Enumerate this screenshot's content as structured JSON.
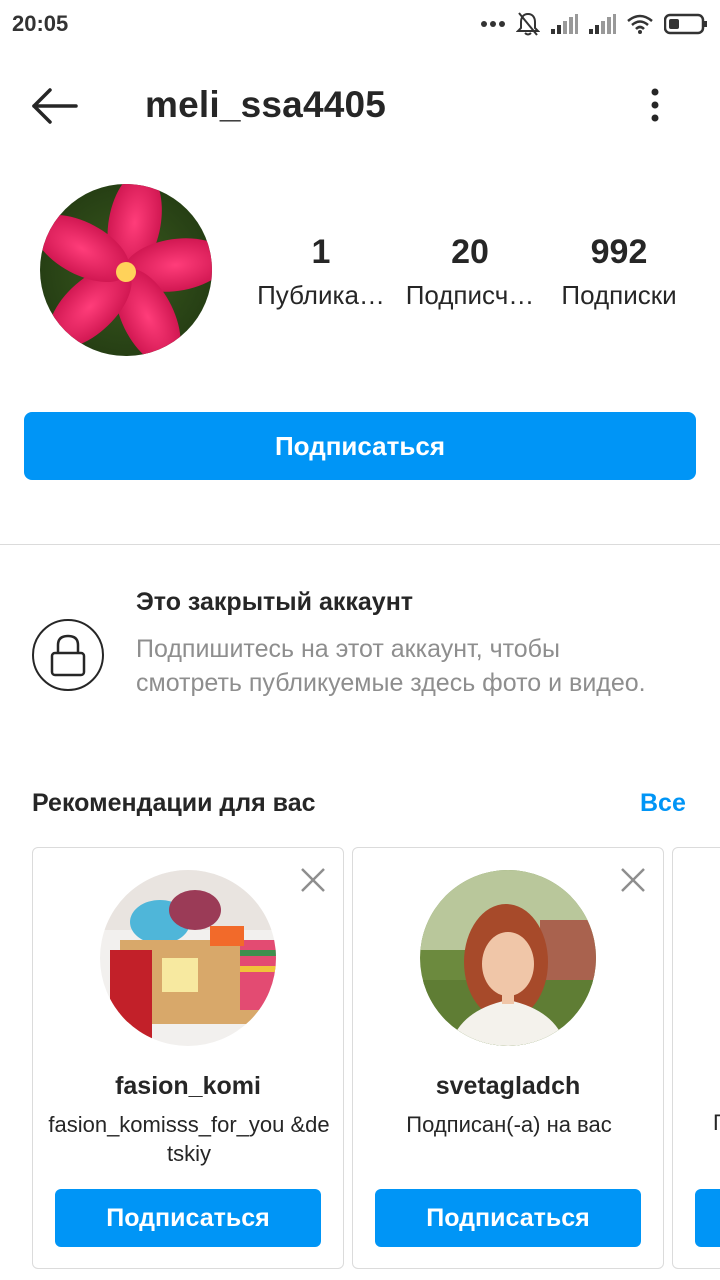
{
  "status_bar": {
    "time": "20:05",
    "icons": [
      "dots-icon",
      "bell-muted-icon",
      "signal-icon",
      "signal-icon",
      "wifi-icon",
      "battery-icon"
    ]
  },
  "header": {
    "username": "meli_ssa4405",
    "back_icon": "arrow-left-icon",
    "more_icon": "more-vertical-icon"
  },
  "profile": {
    "stats": [
      {
        "value": "1",
        "label": "Публика…"
      },
      {
        "value": "20",
        "label": "Подписч…"
      },
      {
        "value": "992",
        "label": "Подписки"
      }
    ],
    "follow_label": "Подписаться"
  },
  "private": {
    "title": "Это закрытый аккаунт",
    "description": "Подпишитесь на этот аккаунт, чтобы смотреть публикуемые здесь фото и видео.",
    "icon": "lock-icon"
  },
  "recommendations": {
    "title": "Рекомендации для вас",
    "see_all": "Все",
    "cards": [
      {
        "username": "fasion_komi",
        "subtitle": "fasion_komisss_for_you &detskiy",
        "follow_label": "Подписаться"
      },
      {
        "username": "svetagladch",
        "subtitle": "Подписан(-а) на вас",
        "follow_label": "Подписаться"
      }
    ],
    "partial_card_text": "П"
  },
  "colors": {
    "accent": "#0095f6",
    "text": "#262626",
    "muted": "#8e8e8e",
    "border": "#dbdbdb"
  }
}
